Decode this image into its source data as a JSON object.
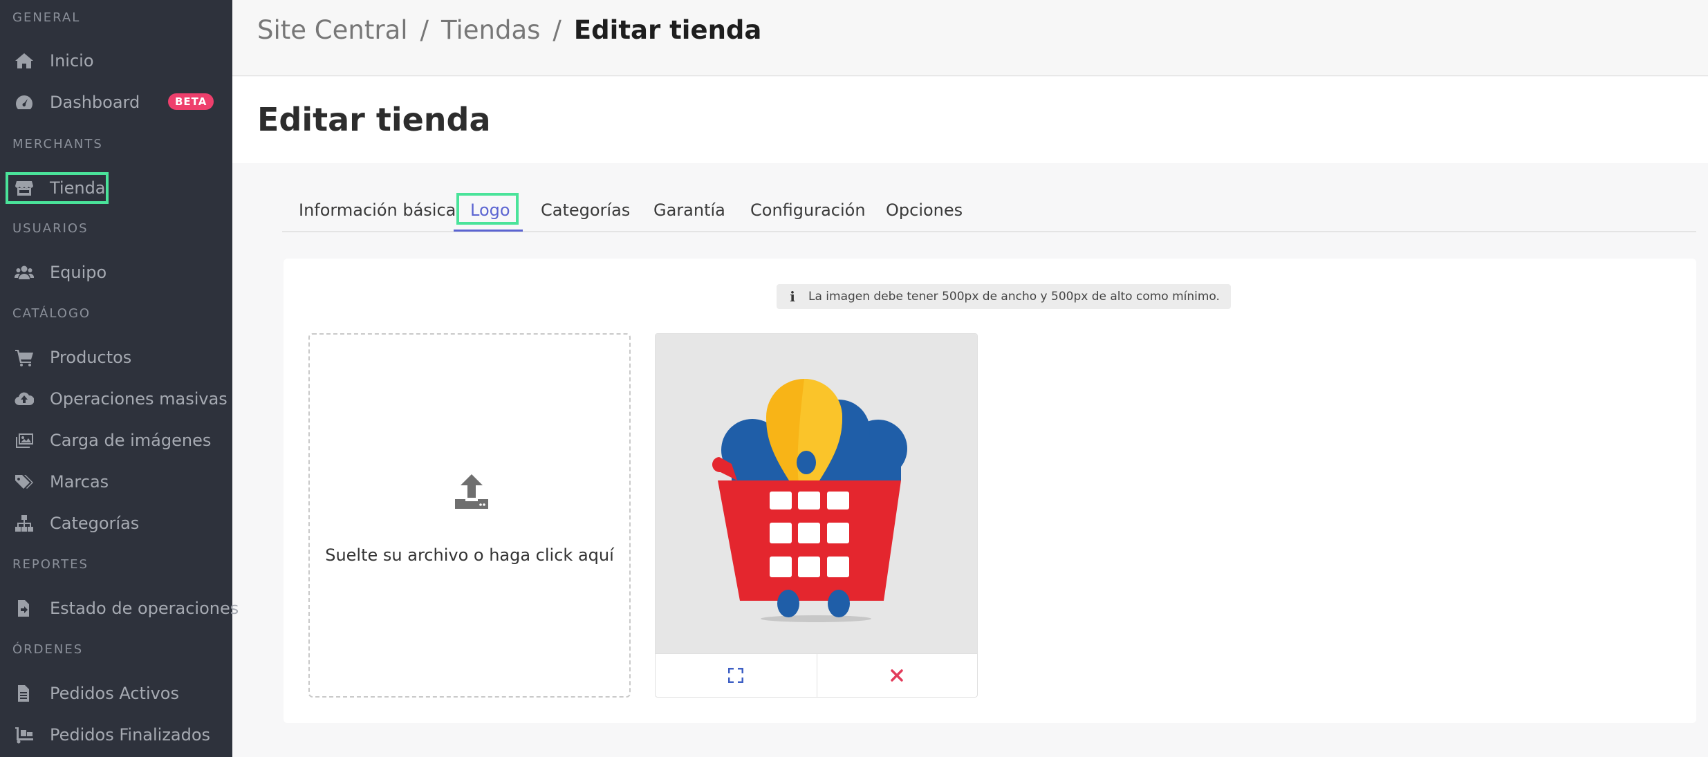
{
  "sidebar": {
    "sections": [
      {
        "title": "GENERAL"
      },
      {
        "title": "MERCHANTS"
      },
      {
        "title": "USUARIOS"
      },
      {
        "title": "CATÁLOGO"
      },
      {
        "title": "REPORTES"
      },
      {
        "title": "ÓRDENES"
      }
    ],
    "items": [
      {
        "label": "Inicio",
        "icon": "home-icon"
      },
      {
        "label": "Dashboard",
        "icon": "gauge-icon",
        "badge": "BETA"
      },
      {
        "label": "Tienda",
        "icon": "store-icon",
        "highlighted": true
      },
      {
        "label": "Equipo",
        "icon": "users-icon"
      },
      {
        "label": "Productos",
        "icon": "cart-icon"
      },
      {
        "label": "Operaciones masivas",
        "icon": "cloud-upload-icon"
      },
      {
        "label": "Carga de imágenes",
        "icon": "images-icon"
      },
      {
        "label": "Marcas",
        "icon": "tags-icon"
      },
      {
        "label": "Categorías",
        "icon": "sitemap-icon"
      },
      {
        "label": "Estado de operaciones",
        "icon": "file-export-icon"
      },
      {
        "label": "Pedidos Activos",
        "icon": "file-text-icon"
      },
      {
        "label": "Pedidos Finalizados",
        "icon": "dolly-icon"
      }
    ]
  },
  "breadcrumb": {
    "items": [
      "Site Central",
      "Tiendas"
    ],
    "separator": "/",
    "current": "Editar tienda"
  },
  "page": {
    "title": "Editar tienda"
  },
  "tabs": [
    {
      "label": "Información básica"
    },
    {
      "label": "Logo",
      "active": true
    },
    {
      "label": "Categorías"
    },
    {
      "label": "Garantía"
    },
    {
      "label": "Configuración"
    },
    {
      "label": "Opciones"
    }
  ],
  "upload": {
    "info_text": "La imagen debe tener 500px de ancho y 500px de alto como mínimo.",
    "dropzone_text": "Suelte su archivo o haga click aquí",
    "preview_actions": [
      {
        "icon": "expand-icon"
      },
      {
        "icon": "close-icon"
      }
    ]
  },
  "colors": {
    "sidebar_bg": "#2e323c",
    "accent": "#5b64d1",
    "highlight": "#4ae39a",
    "beta_badge": "#ee3f6c",
    "remove": "#e23b5a"
  }
}
